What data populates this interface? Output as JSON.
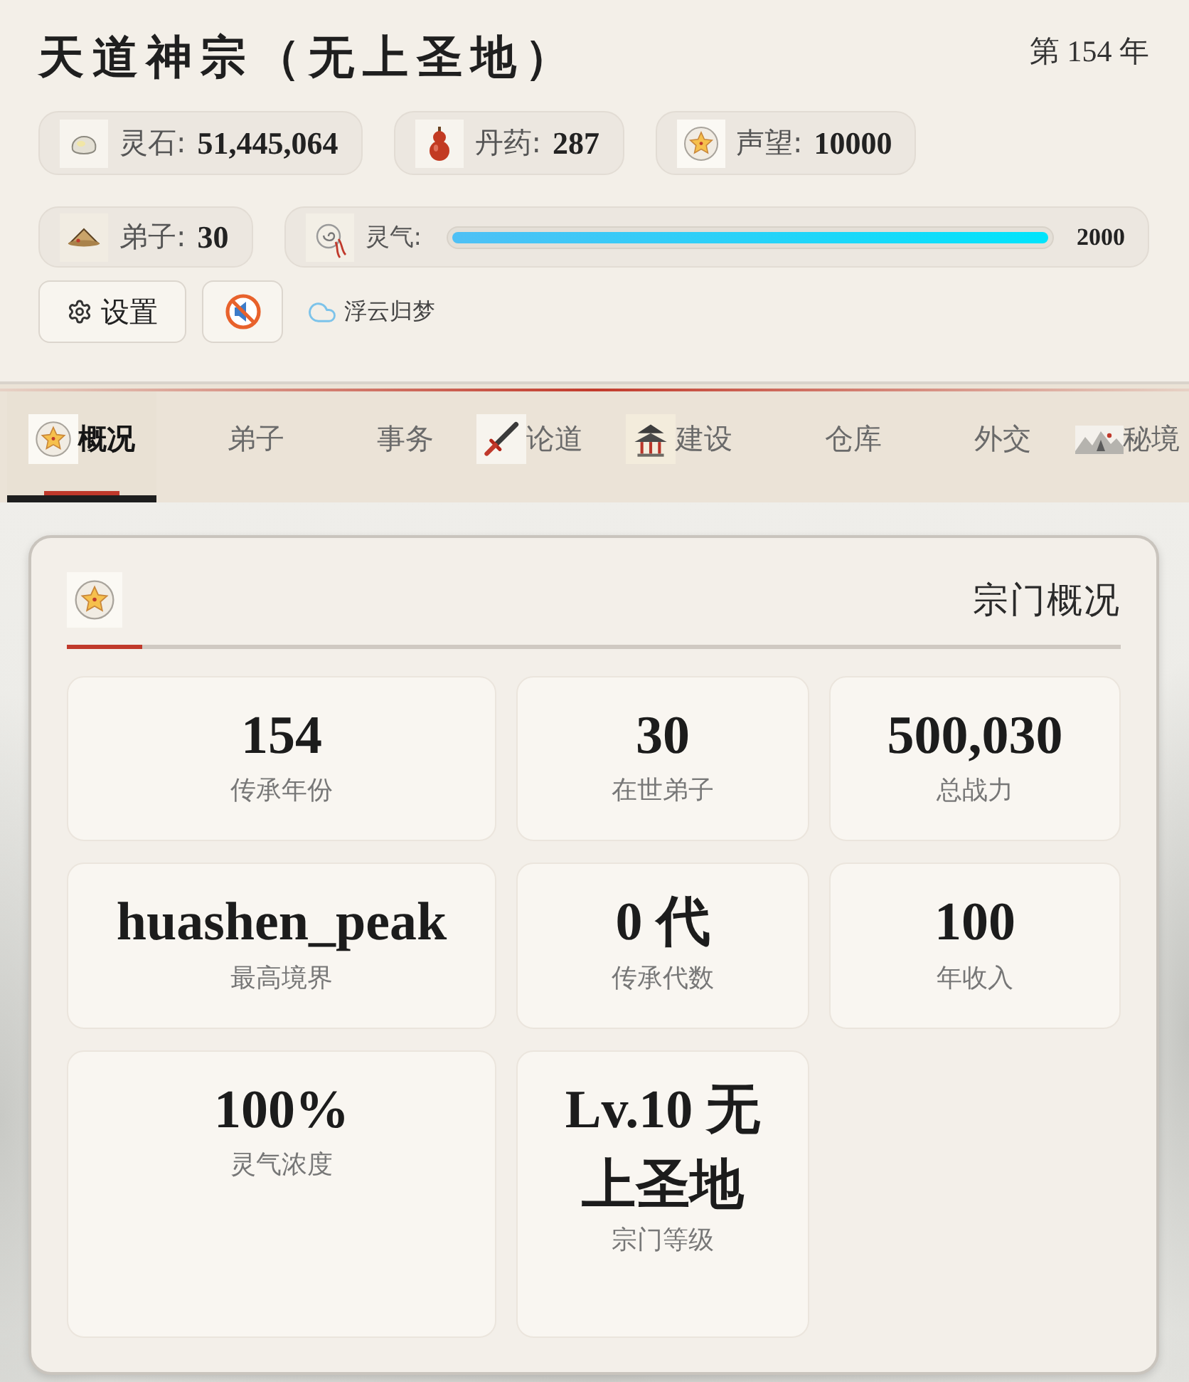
{
  "header": {
    "title": "天道神宗（无上圣地）",
    "year": "第 154 年"
  },
  "resources": [
    {
      "label": "灵石:",
      "value": "51,445,064"
    },
    {
      "label": "丹药:",
      "value": "287"
    },
    {
      "label": "声望:",
      "value": "10000"
    }
  ],
  "disciples": {
    "label": "弟子:",
    "value": "30"
  },
  "spirit_qi": {
    "label": "灵气:",
    "level": 1,
    "reading": "2000"
  },
  "controls": {
    "settings": "设置",
    "sound_muted": true,
    "music_track": "浮云归梦"
  },
  "tabs": [
    {
      "label": "概况",
      "selected": true
    },
    {
      "label": "弟子",
      "selected": false
    },
    {
      "label": "事务",
      "selected": false
    },
    {
      "label": "论道",
      "selected": false
    },
    {
      "label": "建设",
      "selected": false
    },
    {
      "label": "仓库",
      "selected": false
    },
    {
      "label": "外交",
      "selected": false
    },
    {
      "label": "秘境",
      "selected": false
    }
  ],
  "overview": {
    "title": "宗门概况",
    "stats": [
      {
        "value": "154",
        "label": "传承年份"
      },
      {
        "value": "30",
        "label": "在世弟子"
      },
      {
        "value": "500,030",
        "label": "总战力"
      },
      {
        "value": "huashen_peak",
        "label": "最高境界"
      },
      {
        "value": "0 代",
        "label": "传承代数"
      },
      {
        "value": "100",
        "label": "年收入"
      },
      {
        "value": "100%",
        "label": "灵气浓度"
      },
      {
        "value": "Lv.10 无上圣地",
        "label": "宗门等级"
      }
    ]
  }
}
